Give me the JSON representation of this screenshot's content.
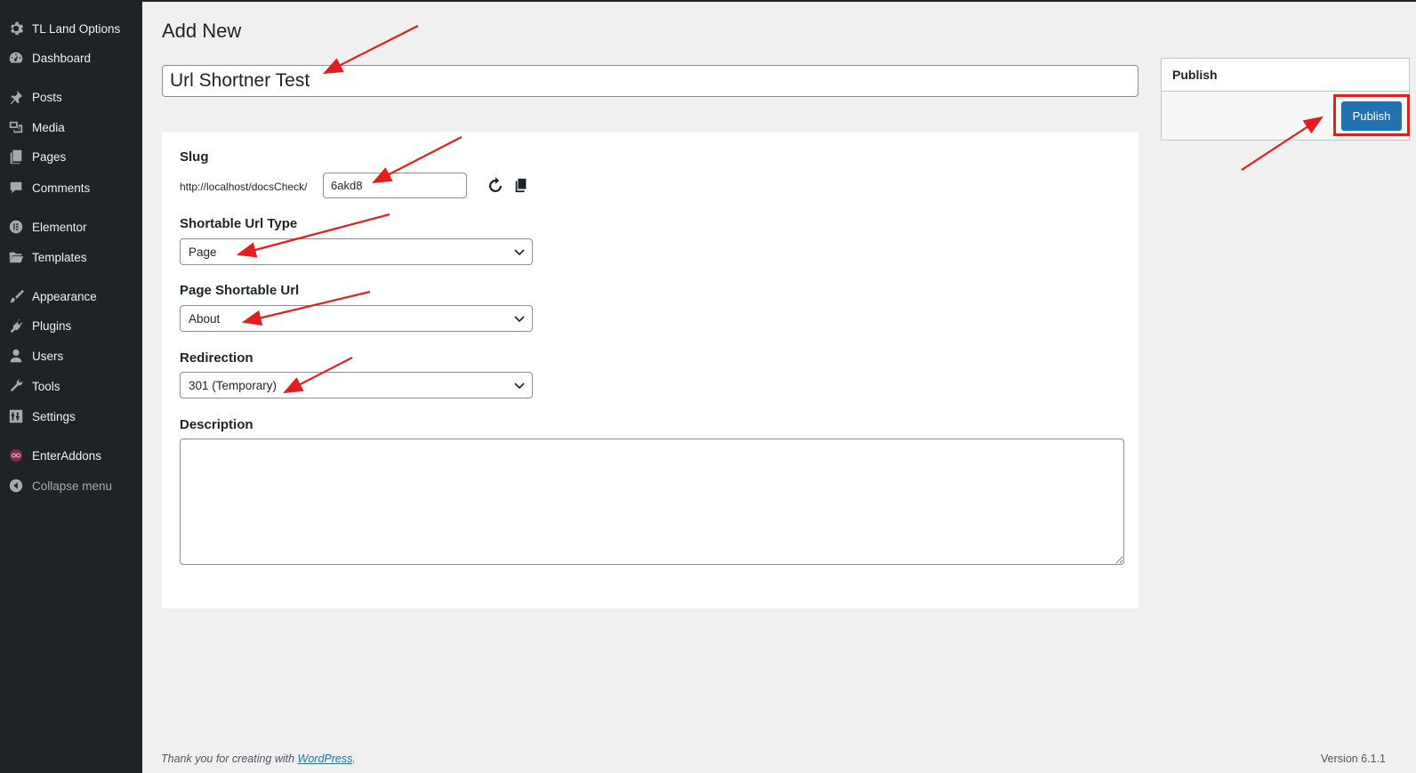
{
  "sidebar": {
    "items": [
      {
        "label": "TL Land Options",
        "icon": "gear-icon"
      },
      {
        "label": "Dashboard",
        "icon": "dashboard-icon"
      },
      {
        "label": "Posts",
        "icon": "pin-icon"
      },
      {
        "label": "Media",
        "icon": "media-icon"
      },
      {
        "label": "Pages",
        "icon": "pages-icon"
      },
      {
        "label": "Comments",
        "icon": "comment-icon"
      },
      {
        "label": "Elementor",
        "icon": "elementor-icon"
      },
      {
        "label": "Templates",
        "icon": "folder-icon"
      },
      {
        "label": "Appearance",
        "icon": "brush-icon"
      },
      {
        "label": "Plugins",
        "icon": "plugin-icon"
      },
      {
        "label": "Users",
        "icon": "user-icon"
      },
      {
        "label": "Tools",
        "icon": "wrench-icon"
      },
      {
        "label": "Settings",
        "icon": "settings-icon"
      },
      {
        "label": "EnterAddons",
        "icon": "enteraddons-icon"
      },
      {
        "label": "Collapse menu",
        "icon": "collapse-icon"
      }
    ]
  },
  "main": {
    "title": "Add New",
    "post_title_value": "Url Shortner Test",
    "slug": {
      "label": "Slug",
      "prefix": "http://localhost/docsCheck/",
      "value": "6akd8",
      "refresh_icon": "refresh-icon",
      "copy_icon": "copy-icon"
    },
    "url_type": {
      "label": "Shortable Url Type",
      "selected": "Page"
    },
    "page_url": {
      "label": "Page Shortable Url",
      "selected": "About"
    },
    "redirection": {
      "label": "Redirection",
      "selected": "301 (Temporary)"
    },
    "description": {
      "label": "Description",
      "value": ""
    }
  },
  "publish": {
    "heading": "Publish",
    "button_label": "Publish"
  },
  "footer": {
    "thanks_prefix": "Thank you for creating with ",
    "wp_link": "WordPress",
    "thanks_suffix": ".",
    "version": "Version 6.1.1"
  },
  "colors": {
    "sidebar_bg": "#1d2327",
    "primary_button": "#2271b1",
    "annotation_red": "#e41e1e",
    "page_bg": "#f0f0f1"
  }
}
